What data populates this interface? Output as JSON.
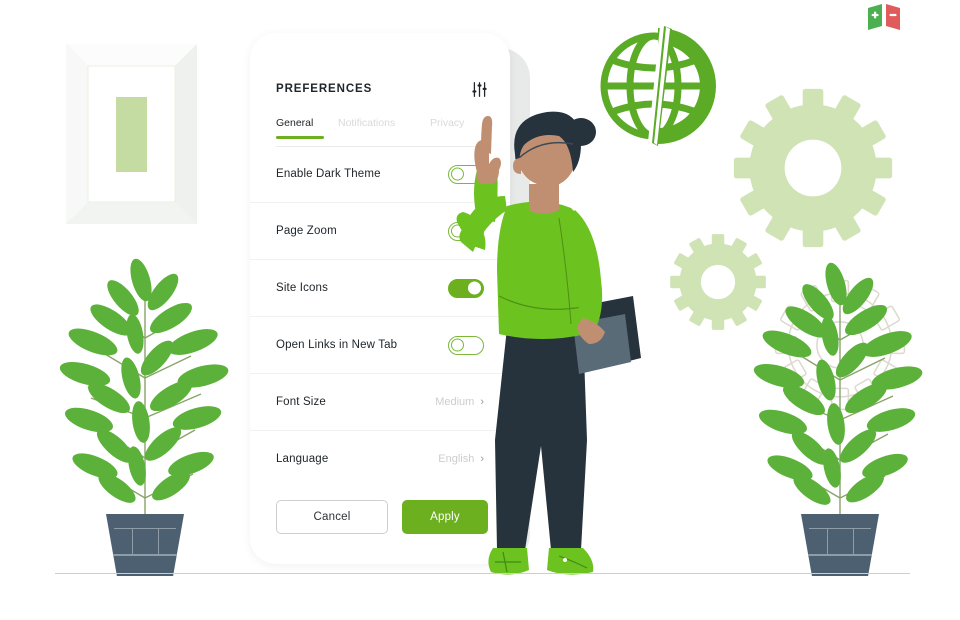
{
  "scene": {
    "background_color": "#ffffff",
    "accent_green": "#6cb020",
    "leaf_green": "#5cb13a",
    "pale_green": "#cfe3b5",
    "pot_color": "#4d6072",
    "dark_navy": "#26323c",
    "ground_line_color": "#c9cfd2"
  },
  "logo": {
    "name": "plus-minus-logo",
    "left_color": "#4caf50",
    "right_color": "#e05b5b",
    "left_symbol": "+",
    "right_symbol": "−"
  },
  "card": {
    "title": "PREFERENCES",
    "settings_icon": "sliders-icon",
    "tabs": [
      {
        "label": "General",
        "active": true
      },
      {
        "label": "Notifications",
        "active": false
      },
      {
        "label": "Privacy",
        "active": false
      }
    ],
    "rows": [
      {
        "label": "Enable Dark Theme",
        "control": "toggle",
        "state": "off"
      },
      {
        "label": "Page Zoom",
        "control": "toggle",
        "state": "off"
      },
      {
        "label": "Site Icons",
        "control": "toggle",
        "state": "on"
      },
      {
        "label": "Open Links in New Tab",
        "control": "toggle",
        "state": "off"
      },
      {
        "label": "Font Size",
        "control": "value",
        "value": "Medium",
        "chevron": "›"
      },
      {
        "label": "Language",
        "control": "value",
        "value": "English",
        "chevron": "›"
      }
    ],
    "buttons": {
      "cancel_label": "Cancel",
      "apply_label": "Apply"
    }
  },
  "decor": {
    "picture_frame": "framed-picture",
    "globe": "globe-icon",
    "gear_large": "gear-large",
    "gear_small": "gear-small",
    "gear_outline": "gear-outline",
    "plant_left": "potted-plant-left",
    "plant_right": "potted-plant-right",
    "person": "person-illustration"
  }
}
